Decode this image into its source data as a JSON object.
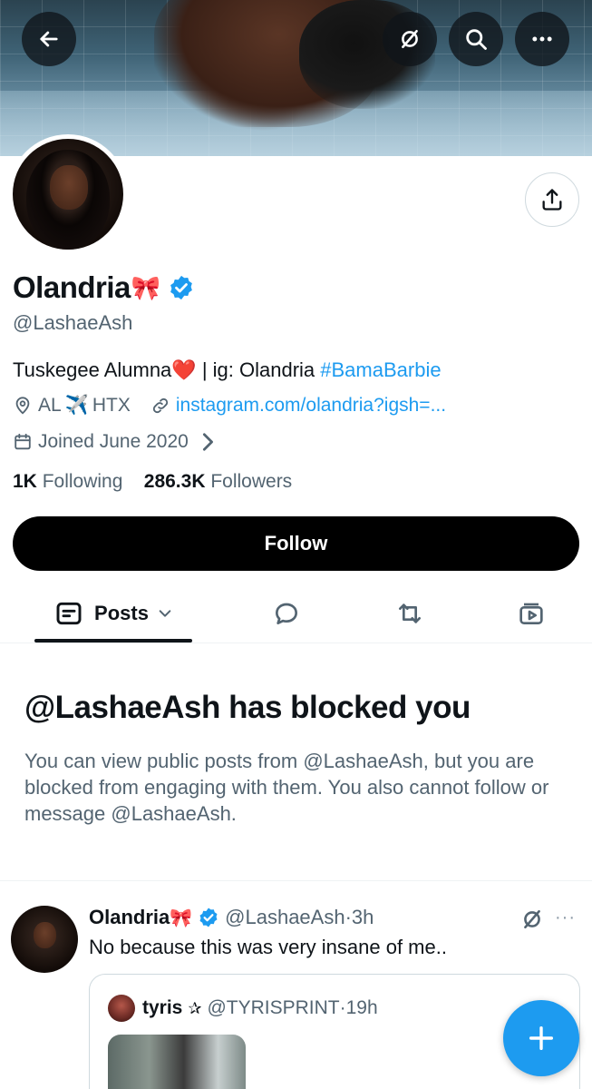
{
  "profile": {
    "display_name": "Olandria",
    "bow_emoji": "🎀",
    "handle": "@LashaeAsh",
    "bio": {
      "part1": "Tuskegee Alumna",
      "heart": "❤️",
      "part2": " | ig: Olandria ",
      "hashtag": "#BamaBarbie"
    },
    "location": {
      "text1": "AL",
      "plane_emoji": "✈️",
      "text2": "HTX"
    },
    "website": "instagram.com/olandria?igsh=...",
    "joined": "Joined June 2020",
    "following_count": "1K",
    "following_label": "Following",
    "followers_count": "286.3K",
    "followers_label": "Followers"
  },
  "actions": {
    "follow_label": "Follow"
  },
  "tabs": {
    "posts_label": "Posts"
  },
  "blocked": {
    "title": "@LashaeAsh has blocked you",
    "message": "You can view public posts from @LashaeAsh, but you are blocked from engaging with them. You also cannot follow or message @LashaeAsh."
  },
  "post": {
    "author_name": "Olandria",
    "bow_emoji": "🎀",
    "author_handle": "@LashaeAsh",
    "separator": "·",
    "time": "3h",
    "more": "···",
    "text": "No because this was very insane of me..",
    "quote": {
      "author_name": "tyris",
      "star": "✰",
      "author_handle": "@TYRISPRINT",
      "separator": "·",
      "time": "19h"
    }
  },
  "icons": {
    "back": "arrow-left-icon",
    "grok": "grok-icon",
    "search": "search-icon",
    "more": "more-icon",
    "share": "share-icon",
    "verified": "verified-badge-icon",
    "location": "location-pin-icon",
    "link": "link-icon",
    "calendar": "calendar-icon",
    "compose": "plus-icon"
  },
  "colors": {
    "accent": "#1d9bf0",
    "text_primary": "#0f1419",
    "text_secondary": "#536471",
    "follow_button": "#000000"
  }
}
